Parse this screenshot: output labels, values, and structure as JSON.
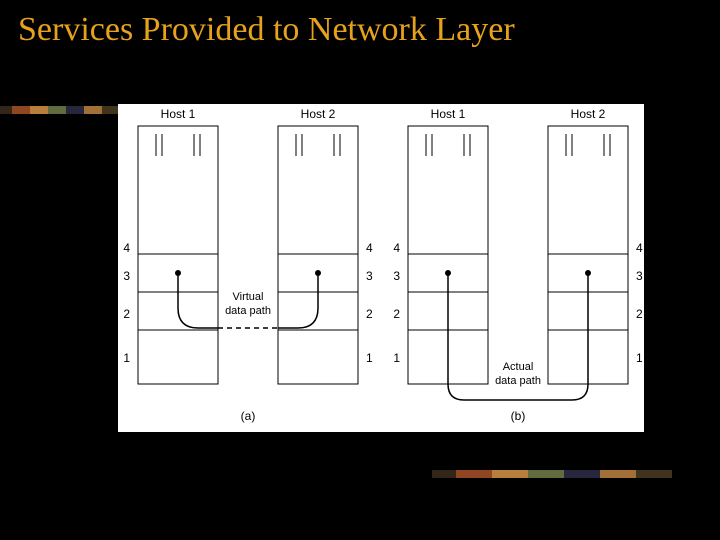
{
  "title": "Services Provided to Network Layer",
  "diagram": {
    "hosts_left": {
      "h1": "Host 1",
      "h2": "Host 2"
    },
    "hosts_right": {
      "h1": "Host 1",
      "h2": "Host 2"
    },
    "layers": [
      "4",
      "3",
      "2",
      "1"
    ],
    "virtual_label_l1": "Virtual",
    "virtual_label_l2": "data path",
    "actual_label_l1": "Actual",
    "actual_label_l2": "data path",
    "sub_a": "(a)",
    "sub_b": "(b)"
  },
  "chart_data": {
    "type": "diagram",
    "title": "Services Provided to Network Layer",
    "description": "Two side-by-side protocol stacks (Host 1 and Host 2), each with layers 1–4. (a) shows a virtual data path (dashed) between layer 3 of the two hosts. (b) shows the actual data path going down Host 1's stack through layer 1 across to Host 2's layer 1 and up to layer 3.",
    "subplots": [
      {
        "id": "a",
        "caption": "(a)",
        "hosts": [
          "Host 1",
          "Host 2"
        ],
        "layers_top_to_bottom": [
          4,
          3,
          2,
          1
        ],
        "path_label": "Virtual data path",
        "path_layer": 3,
        "path_style": "dashed"
      },
      {
        "id": "b",
        "caption": "(b)",
        "hosts": [
          "Host 1",
          "Host 2"
        ],
        "layers_top_to_bottom": [
          4,
          3,
          2,
          1
        ],
        "path_label": "Actual data path",
        "path_route": "layer3-host1 → down to layer1-host1 → across to layer1-host2 → up to layer3-host2",
        "path_style": "solid"
      }
    ]
  }
}
